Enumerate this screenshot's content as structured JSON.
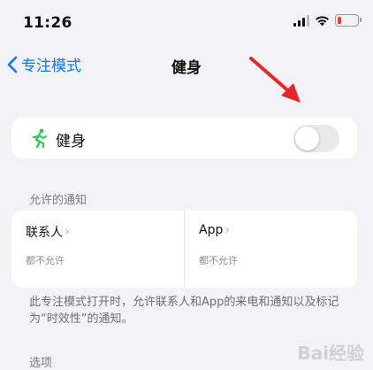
{
  "status_bar": {
    "time": "11:26"
  },
  "nav": {
    "back_label": "专注模式",
    "title": "健身"
  },
  "focus": {
    "label": "健身",
    "toggle_on": false
  },
  "allowed_notifications": {
    "header": "允许的通知",
    "people": {
      "title": "联系人",
      "subtitle": "都不允许"
    },
    "apps": {
      "title": "App",
      "subtitle": "都不允许"
    }
  },
  "footer": {
    "text": "此专注模式打开时，允许联系人和App的来电和通知以及标记为“时效性”的通知。"
  },
  "options": {
    "header": "选项"
  },
  "watermark": {
    "text": "Bai经验"
  },
  "colors": {
    "accent": "#007aff",
    "annotation_arrow": "#e8262a",
    "focus_icon": "#34c759",
    "background": "#f2f2f7"
  },
  "icons": {
    "back": "chevron-left-icon",
    "focus": "running-person-icon",
    "wifi": "wifi-icon",
    "battery": "battery-icon",
    "signal": "signal-icon"
  }
}
